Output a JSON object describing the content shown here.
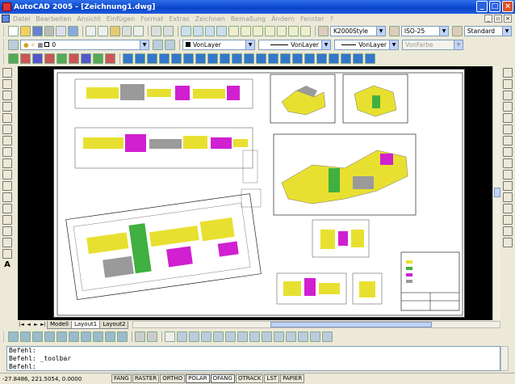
{
  "window": {
    "title": "AutoCAD 2005 - [Zeichnung1.dwg]"
  },
  "menu": {
    "items": [
      "Datei",
      "Bearbeiten",
      "Ansicht",
      "Einfügen",
      "Format",
      "Extras",
      "Zeichnen",
      "Bemaßung",
      "Ändern",
      "Fenster",
      "?"
    ]
  },
  "toolbar_styles": {
    "text_style": "K2000Style",
    "dim_style": "ISO-25",
    "table_style": "Standard"
  },
  "properties_bar": {
    "layer": "0",
    "color": "VonLayer",
    "linetype": "VonLayer",
    "lineweight": "VonLayer",
    "plotstyle": "VonFarbe"
  },
  "layout_tabs": [
    "Modell",
    "Layout1",
    "Layout2"
  ],
  "active_tab": "Layout1",
  "command_lines": [
    "Befehl:",
    "Befehl: _toolbar",
    "Befehl:"
  ],
  "status": {
    "coordinates": "-27.8486, 221.5054, 0.0000",
    "buttons": [
      {
        "label": "FANG",
        "on": false
      },
      {
        "label": "RASTER",
        "on": false
      },
      {
        "label": "ORTHO",
        "on": false
      },
      {
        "label": "POLAR",
        "on": true
      },
      {
        "label": "OFANG",
        "on": true
      },
      {
        "label": "OTRACK",
        "on": false
      },
      {
        "label": "LST",
        "on": false
      },
      {
        "label": "PAPIER",
        "on": false
      }
    ]
  },
  "colors": {
    "title_bar": "#1652d6",
    "canvas_bg": "#000000",
    "paper": "#ffffff",
    "duct_yellow": "#e8e030",
    "duct_magenta": "#d020d0",
    "duct_green": "#40b040",
    "grey_part": "#9a9a9a"
  }
}
